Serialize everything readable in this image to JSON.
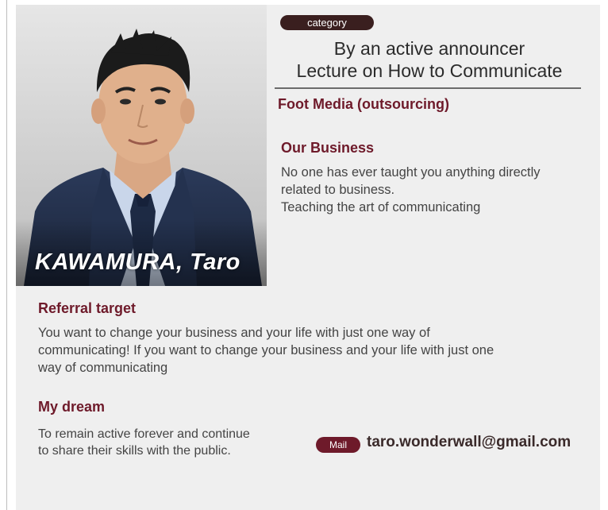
{
  "profile": {
    "name": "KAWAMURA, Taro",
    "category_label": "category",
    "headline_line1": "By an active announcer",
    "headline_line2": "Lecture on How to Communicate",
    "company": "Foot Media (outsourcing)"
  },
  "our_business": {
    "title": "Our Business",
    "line1": "No one has ever taught you anything directly",
    "line2": "related to business.",
    "line3": "Teaching the art of communicating"
  },
  "referral_target": {
    "title": "Referral target",
    "line1": "You want to change your business and your life with just one way of",
    "line2": "communicating! If you want to change your business and your life with just one",
    "line3": "way of communicating"
  },
  "my_dream": {
    "title": "My dream",
    "line1": "To remain active forever and continue",
    "line2": "to share their skills with the public."
  },
  "contact": {
    "mail_label": "Mail",
    "email": "taro.wonderwall@gmail.com"
  },
  "colors": {
    "accent": "#6e1a2a",
    "badge_dark": "#3a1f1f",
    "card_bg": "#efefef"
  }
}
